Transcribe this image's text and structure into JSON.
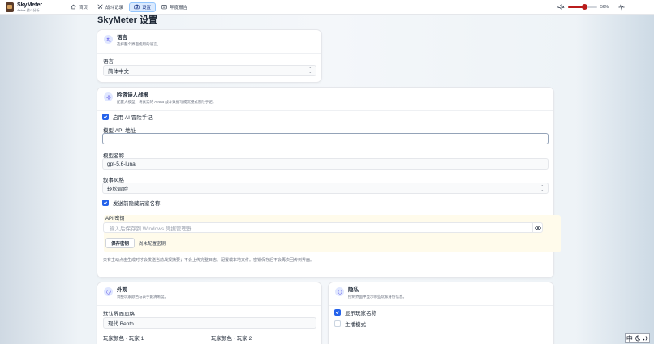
{
  "app": {
    "name": "SkyMeter",
    "subtitle": "Aetna 战斗分析"
  },
  "nav": {
    "tabs": [
      {
        "label": "首页",
        "icon": "home-icon"
      },
      {
        "label": "战斗记录",
        "icon": "swords-icon"
      },
      {
        "label": "设置",
        "icon": "settings-icon",
        "active": true
      },
      {
        "label": "年度报告",
        "icon": "report-icon"
      }
    ]
  },
  "volume": {
    "percent_label": "56%",
    "level": 0.56
  },
  "page": {
    "title": "SkyMeter 设置"
  },
  "language_card": {
    "title": "语言",
    "desc": "选择整个界面使用的语言。",
    "field_label": "语言",
    "value": "简体中文"
  },
  "bard_card": {
    "title": "吟游诗人战报",
    "desc": "配置大模型，将真实的 Aetna 战斗数据写成沉浸式冒险手记。",
    "enable_label": "启用 AI 冒险手记",
    "api_url_label": "模型 API 地址",
    "api_url_value": "",
    "model_label": "模型名称",
    "model_value": "gpt-5.6-luna",
    "style_label": "叙事风格",
    "style_value": "轻松冒险",
    "hide_names_label": "发送前隐藏玩家名称",
    "api_key_label": "API 密钥",
    "api_key_placeholder": "输入后保存到 Windows 凭据管理器",
    "save_key_label": "保存密钥",
    "key_status": "尚未配置密钥",
    "note": "只有主动点击生成时才会发送当前战报摘要；不会上传完整日志、配置或本地文件。密钥保存后不会再次回传到界面。"
  },
  "appearance_card": {
    "title": "外观",
    "desc": "调整玩家颜色与表字影清晰度。",
    "style_label": "默认界面风格",
    "style_value": "现代 Bento",
    "color1_label": "玩家颜色 · 玩家 1",
    "color2_label": "玩家颜色 · 玩家 2"
  },
  "privacy_card": {
    "title": "隐私",
    "desc": "控制界面中显示哪些玩家身份信息。",
    "show_names_label": "显示玩家名称",
    "streamer_label": "主播模式"
  },
  "ime": {
    "label": "中"
  },
  "colors": {
    "accent": "#2563eb",
    "volume": "#b91c1c",
    "warning_bg": "#fffbeb"
  }
}
